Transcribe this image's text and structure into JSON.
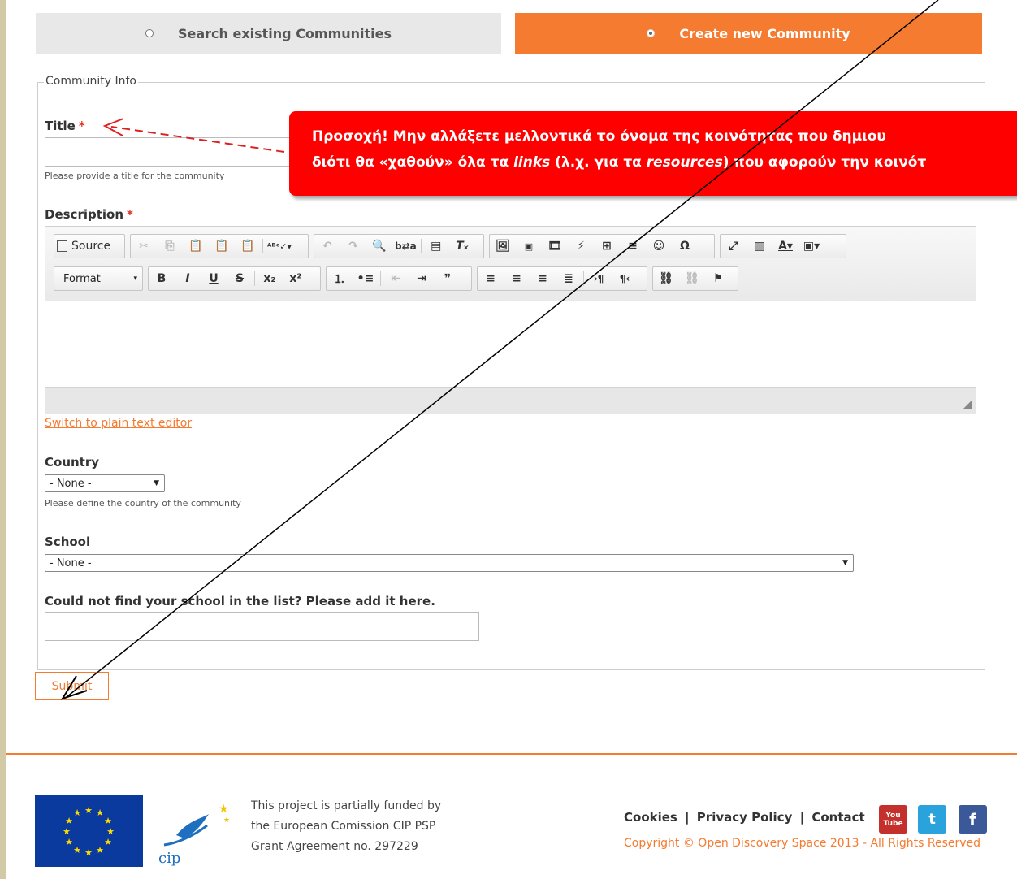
{
  "tabs": {
    "search_label": "Search existing Communities",
    "create_label": "Create new Community"
  },
  "form": {
    "legend": "Community Info",
    "title_label": "Title",
    "required_mark": "*",
    "title_hint": "Please provide a title for the community",
    "description_label": "Description",
    "switch_editor_link": "Switch to plain text editor",
    "country_label": "Country",
    "country_value": "- None -",
    "country_hint": "Please define the country of the community",
    "school_label": "School",
    "school_value": "- None -",
    "add_school_label": "Could not find your school in the list? Please add it here.",
    "submit_label": "Submit"
  },
  "editor": {
    "source_label": "Source",
    "format_label": "Format"
  },
  "callout": {
    "line1": "Προσοχή!  Μην αλλάξετε μελλοντικά το όνομα της κοινότητας που δημιου",
    "line2_a": "διότι θα «χαθούν» όλα τα ",
    "line2_b": "links",
    "line2_c": " (λ.χ. για τα ",
    "line2_d": "resources",
    "line2_e": ") που αφορούν την κοινότ"
  },
  "footer": {
    "fund_line1": "This project is partially funded by",
    "fund_line2": "the European Comission CIP PSP",
    "fund_line3": "Grant Agreement no. 297229",
    "cookies": "Cookies",
    "privacy": "Privacy Policy",
    "contact": "Contact",
    "separator": "|",
    "copyright": "Copyright © Open Discovery Space 2013 - All Rights Reserved",
    "youtube_label": "You Tube",
    "twitter_label": "t",
    "facebook_label": "f",
    "cip_text": "cip"
  },
  "colors": {
    "accent": "#f47b30",
    "callout": "#ff0000",
    "frame": "#d2c9a6"
  }
}
